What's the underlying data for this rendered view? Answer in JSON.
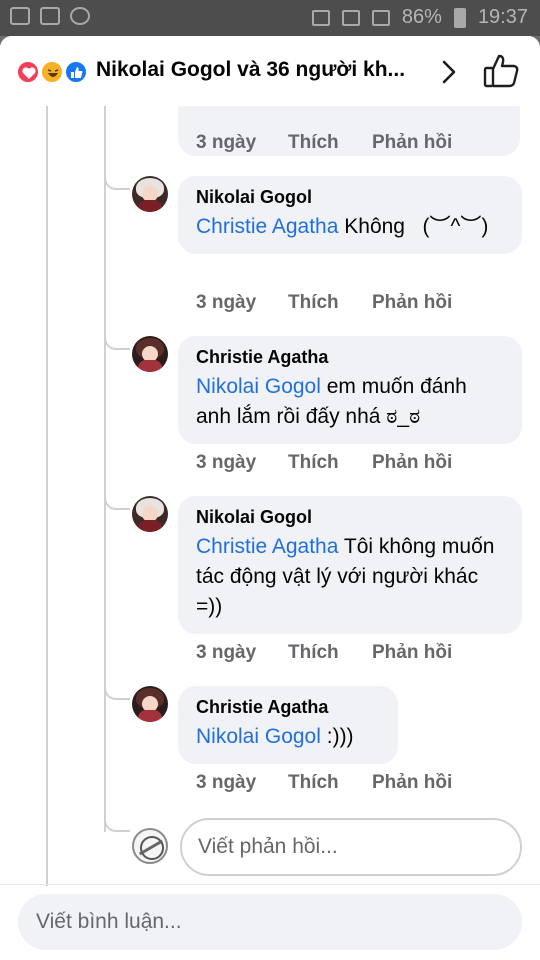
{
  "status_bar": {
    "battery": "86%",
    "time": "19:37"
  },
  "header": {
    "reaction_icons": [
      "love-icon",
      "haha-icon",
      "like-icon"
    ],
    "title": "Nikolai Gogol và 36 người kh..."
  },
  "comments": [
    {
      "author": "",
      "mention": "",
      "text": "",
      "time": "3 ngày",
      "like": "Thích",
      "reply": "Phản hồi"
    },
    {
      "author": "Nikolai Gogol",
      "mention": "Christie Agatha",
      "text": " Không   (︶^︶)",
      "time": "3 ngày",
      "like": "Thích",
      "reply": "Phản hồi"
    },
    {
      "author": "Christie Agatha",
      "mention": "Nikolai Gogol",
      "text": " em muốn đánh anh lắm rồi đấy nhá ಠ_ಠ",
      "time": "3 ngày",
      "like": "Thích",
      "reply": "Phản hồi"
    },
    {
      "author": "Nikolai Gogol",
      "mention": "Christie Agatha",
      "text": " Tôi không muốn tác động vật lý với người khác =))",
      "time": "3 ngày",
      "like": "Thích",
      "reply": "Phản hồi"
    },
    {
      "author": "Christie Agatha",
      "mention": "Nikolai Gogol",
      "text": " :)))",
      "time": "3 ngày",
      "like": "Thích",
      "reply": "Phản hồi"
    }
  ],
  "reply_input": {
    "placeholder": "Viết phản hồi..."
  },
  "comment_input": {
    "placeholder": "Viết bình luận..."
  }
}
